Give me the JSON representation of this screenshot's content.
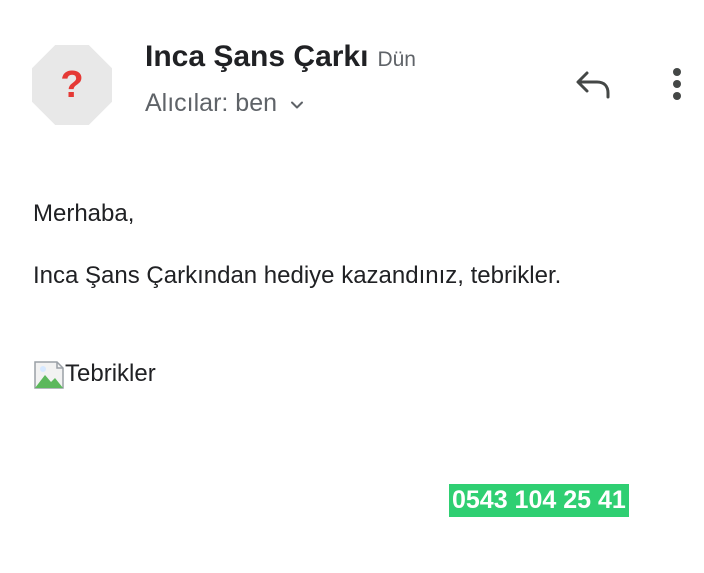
{
  "email": {
    "sender": {
      "avatar_glyph": "?",
      "name": "Inca Şans Çarkı",
      "time": "Dün"
    },
    "recipients_label": "Alıcılar: ben",
    "actions": {
      "reply_icon": "reply-icon",
      "more_icon": "more-vert-icon"
    },
    "body": {
      "greeting": "Merhaba,",
      "message": "Inca Şans Çarkından hediye kazandınız, tebrikler.",
      "image_alt": "Tebrikler",
      "phone": "0543 104 25 41"
    }
  },
  "colors": {
    "avatar_bg": "#e8e8e8",
    "avatar_glyph": "#e53935",
    "phone_highlight": "#2fcf72",
    "secondary_text": "#5f6368",
    "primary_text": "#202124"
  }
}
